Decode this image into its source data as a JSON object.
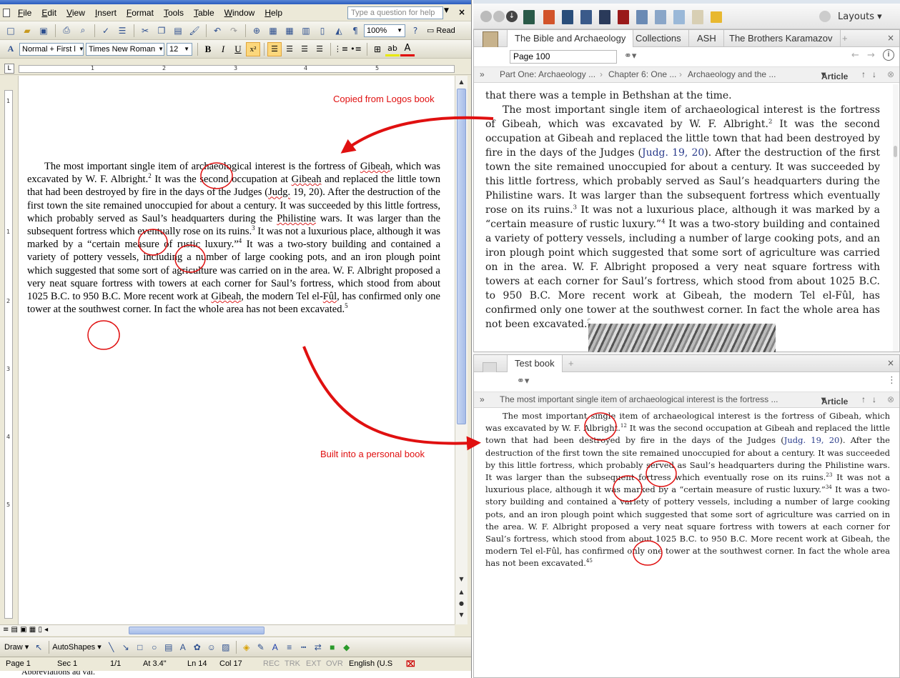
{
  "word": {
    "menu": [
      {
        "u": "F",
        "rest": "ile"
      },
      {
        "u": "E",
        "rest": "dit"
      },
      {
        "u": "V",
        "rest": "iew"
      },
      {
        "u": "I",
        "rest": "nsert"
      },
      {
        "u": "F",
        "rest": "ormat"
      },
      {
        "u": "T",
        "rest": "ools"
      },
      {
        "u": "T",
        "rest": "able"
      },
      {
        "u": "W",
        "rest": "indow"
      },
      {
        "u": "H",
        "rest": "elp"
      }
    ],
    "help_placeholder": "Type a question for help",
    "zoom": "100%",
    "read_label": "Read",
    "style": "Normal + First l",
    "font": "Times New Roman",
    "size": "12",
    "ruler_h": [
      "1",
      "2",
      "3",
      "4",
      "5"
    ],
    "ruler_v": [
      "1",
      "1",
      "2",
      "3",
      "4",
      "5"
    ],
    "doc": {
      "s1": "The most important single item of archaeological interest is the fortress of ",
      "gibeah": "Gibeah",
      "s2": ", which was excavated by W. F. Albright.",
      "fn2": "2",
      "s3": " It was the second occupation at ",
      "s4": " and replaced the little town that had been destroyed by fire in the days of the Judges (",
      "judg": "Judg.",
      "s5": " 19, 20). After the destruction of the first town the site remained unoccupied for about a century. It was succeeded by this little fortress, which probably served as Saul’s headquarters during the ",
      "philistine": "Philistine",
      "s6": " wars. It was larger than the subsequent fortress which eventually rose on its ruins.",
      "fn3": "3",
      "s7": " It was not a luxurious place, although it was marked by a “certain measure of rustic luxury.”",
      "fn4": "4",
      "s8": " It was a two-story building and contained a variety of pottery vessels, including a number of large cooking pots, and an iron plough point which suggested that some sort of agriculture was carried on in the area. W. F. Albright proposed a very neat square fortress with towers at each corner for Saul’s fortress, which stood from about 1025 B.C. to 950 B.C. More recent work at ",
      "s9": ", the modern Tel el-",
      "ful": "Fûl",
      "s10": ", has confirmed only one tower at the southwest corner. In fact the whole area has not been excavated.",
      "fn5": "5"
    },
    "drawbar": {
      "draw": "Draw",
      "autoshapes": "AutoShapes"
    },
    "status": {
      "page": "Page 1",
      "sec": "Sec 1",
      "pages": "1/1",
      "at": "At 3.4\"",
      "ln": "Ln 14",
      "col": "Col 17",
      "rec": "REC",
      "trk": "TRK",
      "ext": "EXT",
      "ovr": "OVR",
      "lang": "English (U.S"
    },
    "taskstrip": "Abbreviations  ad  val."
  },
  "annotations": {
    "copied": "Copied from Logos book",
    "built": "Built into a personal book"
  },
  "logos": {
    "layouts": "Layouts",
    "top": {
      "tabs": [
        "The Bible and Archaeology",
        "Collections",
        "ASH",
        "The Brothers Karamazov"
      ],
      "add": "+",
      "page_field": "Page 100",
      "crumbs": [
        "Part One: Archaeology ...",
        "Chapter 6: One ...",
        "Archaeology and the ..."
      ],
      "article": "Article",
      "intro": "that there was a temple in Bethshan at the time.",
      "p1": "The most important single item of archaeological interest is the fortress of Gibeah, which was excavated by W. F. Albright.",
      "fn2": "2",
      "p2": " It was the second occupation at Gibeah and replaced the little town that had been destroyed by fire in the days of the Judges (",
      "ref": "Judg. 19, 20",
      "p3": "). After the destruction of the first town the site remained unoccupied for about a century. It was succeeded by this little fortress, which probably served as Saul’s headquarters during the Philistine wars. It was larger than the subsequent fortress which eventually rose on its ruins.",
      "fn3": "3",
      "p4": " It was not a luxurious place, although it was marked by a “certain measure of rustic luxury.”",
      "fn4": "4",
      "p5": " It was a two-story building and contained a variety of pottery vessels, including a number of large cooking pots, and an iron plough point which suggested that some sort of agriculture was carried on in the area. W. F. Albright proposed a very neat square fortress with towers at each corner for Saul’s fortress, which stood from about 1025 B.C. to 950 B.C. More recent work at Gibeah, the modern Tel el-Fûl, has confirmed only one tower at the southwest corner. In fact the whole area has not been excavated.",
      "fn5": "5"
    },
    "bottom": {
      "tab": "Test book",
      "add": "+",
      "crumb": "The most important single item of archaeological interest is the fortress ...",
      "article": "Article",
      "p1": "The most important single item of archaeological interest is the fortress of Gibeah, which was excavated by W. F. Albright.",
      "fn12": "12",
      "p2": " It was the second occupation at Gibeah and replaced the little town that had been destroyed by fire in the days of the Judges (",
      "ref": "Judg. 19, 20",
      "p3": "). After the destruction of the first town the site remained unoccupied for about a century. It was succeeded by this little fortress, which probably served as Saul’s headquarters during the Philistine wars. It was larger than the subsequent fortress which eventually rose on its ruins.",
      "fn23": "23",
      "p4": " It was not a luxurious place, although it was marked by a “certain measure of rustic luxury.”",
      "fn34": "34",
      "p5": " It was a two-story building and contained a variety of pottery vessels, including a number of large cooking pots, and an iron plough point which suggested that some sort of agriculture was carried on in the area. W. F. Albright proposed a very neat square fortress with towers at each corner for Saul’s fortress, which stood from about 1025 B.C. to 950 B.C. More recent work at Gibeah, the modern Tel el-Fûl, has confirmed only one tower at the southwest corner. In fact the whole area has not been excavated.",
      "fn45": "45"
    }
  },
  "colors": {
    "annotation_red": "#e01010",
    "link_blue": "#2a3c8c",
    "word_chrome": "#ece9d8"
  }
}
